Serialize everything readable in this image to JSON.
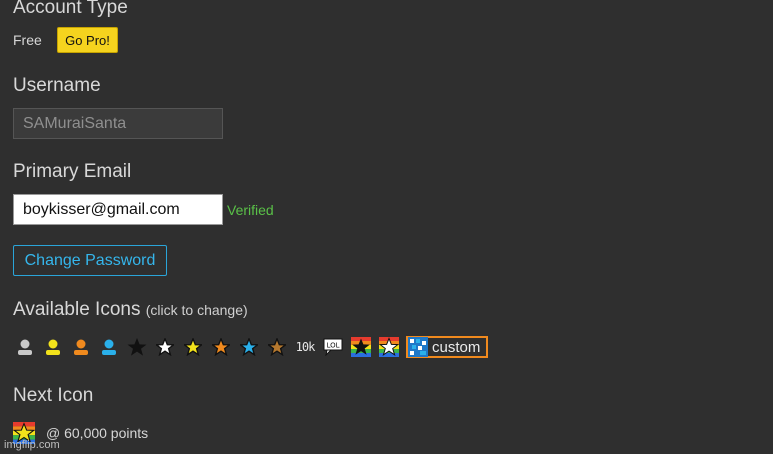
{
  "account_type": {
    "heading": "Account Type",
    "plan": "Free",
    "upgrade_label": "Go Pro!"
  },
  "username": {
    "heading": "Username",
    "value": "SAMuraiSanta"
  },
  "email": {
    "heading": "Primary Email",
    "value": "boykisser@gmail.com",
    "status": "Verified"
  },
  "change_password_label": "Change Password",
  "icons": {
    "heading": "Available Icons",
    "hint": "(click to change)",
    "items": [
      "user-gray-icon",
      "user-yellow-icon",
      "user-orange-icon",
      "user-blue-icon",
      "star-black-icon",
      "star-white-icon",
      "star-yellow-icon",
      "star-orange-icon",
      "star-blue-icon",
      "star-bronze-icon",
      "10k-icon",
      "lol-bubble-icon",
      "rainbow-star-black-icon",
      "rainbow-star-white-icon"
    ],
    "ten_k_label": "10k",
    "lol_label": "LOL",
    "custom_label": "custom"
  },
  "next_icon": {
    "heading": "Next Icon",
    "text": "@ 60,000 points"
  },
  "watermark": "imgflip.com",
  "colors": {
    "background": "#2f2f2f",
    "accent_blue": "#35b6ec",
    "go_pro": "#f5d31e",
    "verified": "#5ac148",
    "custom_border": "#f08a1e"
  }
}
